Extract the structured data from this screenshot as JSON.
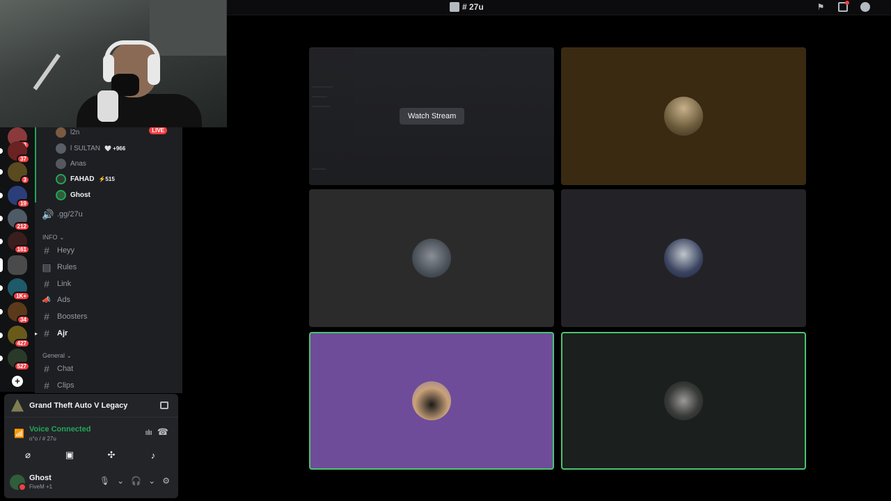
{
  "topbar": {
    "channel": "# 27u",
    "icons": [
      "inbox-flag-icon",
      "record-icon",
      "help-icon"
    ]
  },
  "voice_members": [
    {
      "name": "l2n",
      "bright": false,
      "tag": "",
      "live": "LIVE"
    },
    {
      "name": "l SULTAN",
      "bright": false,
      "tag": "🤍 +966",
      "live": ""
    },
    {
      "name": "Anas",
      "bright": false,
      "tag": "",
      "live": ""
    },
    {
      "name": "FAHAD",
      "bright": true,
      "tag": "⚡515",
      "live": ""
    },
    {
      "name": "Ghost",
      "bright": true,
      "tag": "",
      "live": ""
    }
  ],
  "servers": [
    {
      "badge": "13"
    },
    {
      "badge": "37"
    },
    {
      "badge": "3"
    },
    {
      "badge": "19"
    },
    {
      "badge": "212"
    },
    {
      "badge": "161"
    },
    {
      "badge": ""
    },
    {
      "badge": "1K+"
    },
    {
      "badge": "34"
    },
    {
      "badge": "427"
    },
    {
      "badge": "527"
    }
  ],
  "channels": {
    "voice_link": ".gg/27u",
    "cat_info": "INFO ⌄",
    "info": [
      {
        "icon": "#",
        "name": "Heyy"
      },
      {
        "icon": "▤",
        "name": "Rules"
      },
      {
        "icon": "#",
        "name": "Link"
      },
      {
        "icon": "📣",
        "name": "Ads"
      },
      {
        "icon": "#",
        "name": "Boosters"
      },
      {
        "icon": "#",
        "name": "Ajr"
      }
    ],
    "cat_general": "General ⌄",
    "general": [
      {
        "icon": "#",
        "name": "Chat"
      },
      {
        "icon": "#",
        "name": "Clips"
      }
    ]
  },
  "activity": {
    "game": "Grand Theft Auto V Legacy"
  },
  "voice": {
    "status": "Voice Connected",
    "location": "o°o / # 27u"
  },
  "user": {
    "name": "Ghost",
    "status": "FiveM +1"
  },
  "stream": {
    "watch_label": "Watch Stream"
  },
  "colors": {
    "accent_green": "#23a559",
    "speaking_border": "#4dc471",
    "live_red": "#f23f43",
    "tile_brown": "#3a2a12",
    "tile_purple": "#6e4c9a"
  }
}
